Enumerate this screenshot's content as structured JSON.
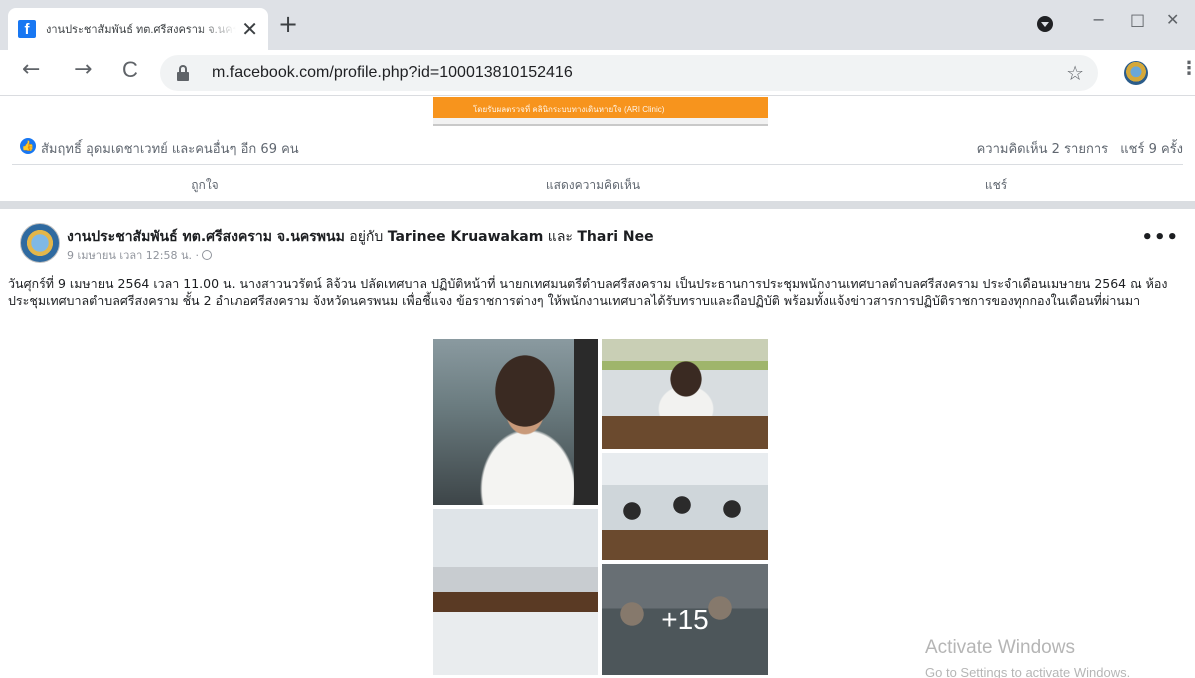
{
  "browser": {
    "tab_title": "งานประชาสัมพันธ์ ทต.ศรีสงคราม จ.นครพนม",
    "tab_close_glyph": "✕",
    "new_tab_glyph": "+",
    "url": "m.facebook.com/profile.php?id=100013810152416",
    "icons": [
      "facebook-favicon",
      "close-icon",
      "plus-icon",
      "profile-icon",
      "back-arrow-icon",
      "forward-arrow-icon",
      "reload-icon",
      "lock-icon",
      "star-icon",
      "extension-avatar-icon",
      "kebab-menu-icon"
    ],
    "window_controls": {
      "minimize": "−",
      "maximize": "□",
      "close": "✕"
    },
    "back_glyph": "←",
    "forward_glyph": "→",
    "reload_glyph": "C",
    "star_glyph": "☆",
    "menu_glyph": "⋮"
  },
  "previous_post": {
    "image_caption": "โดยรับผลตรวจที่ คลินิกระบบทางเดินหายใจ (ARI Clinic)",
    "reactors": "สัมฤทธิ์ อุดมเดชาเวทย์ และคนอื่นๆ อีก 69 คน",
    "comments": "ความคิดเห็น 2 รายการ",
    "shares": "แชร์ 9 ครั้ง",
    "actions": {
      "like": "ถูกใจ",
      "comment": "แสดงความคิดเห็น",
      "share": "แชร์"
    }
  },
  "post": {
    "author": "งานประชาสัมพันธ์ ทต.ศรีสงคราม จ.นครพนม",
    "with_word": "อยู่กับ",
    "tagged_1": "Tarinee Kruawakam",
    "and_word": "และ",
    "tagged_2": "Thari Nee",
    "time": "9 เมษายน เวลา 12:58 น. ·",
    "more_glyph": "•••",
    "text": "วันศุกร์ที่ 9 เมษายน 2564 เวลา 11.00 น. นางสาวนวรัตน์ ลิจ้วน ปลัดเทศบาล ปฏิบัติหน้าที่ นายกเทศมนตรีตำบลศรีสงคราม เป็นประธานการประชุมพนักงานเทศบาลตำบลศรีสงคราม ประจำเดือนเมษายน 2564 ณ ห้องประชุมเทศบาลตำบลศรีสงคราม ชั้น 2 อำเภอศรีสงคราม จังหวัดนครพนม เพื่อชี้แจง ข้อราชการต่างๆ ให้พนักงานเทศบาลได้รับทราบและถือปฏิบัติ พร้อมทั้งแจ้งข่าวสารการปฏิบัติราชการของทุกกองในเดือนที่ผ่านมา",
    "more_photos": "+15"
  },
  "watermark": {
    "line1": "Activate Windows",
    "line2": "Go to Settings to activate Windows."
  },
  "colors": {
    "facebook_blue": "#1877f2",
    "chrome_tabbar": "#dee1e6",
    "muted_text": "#606770"
  }
}
